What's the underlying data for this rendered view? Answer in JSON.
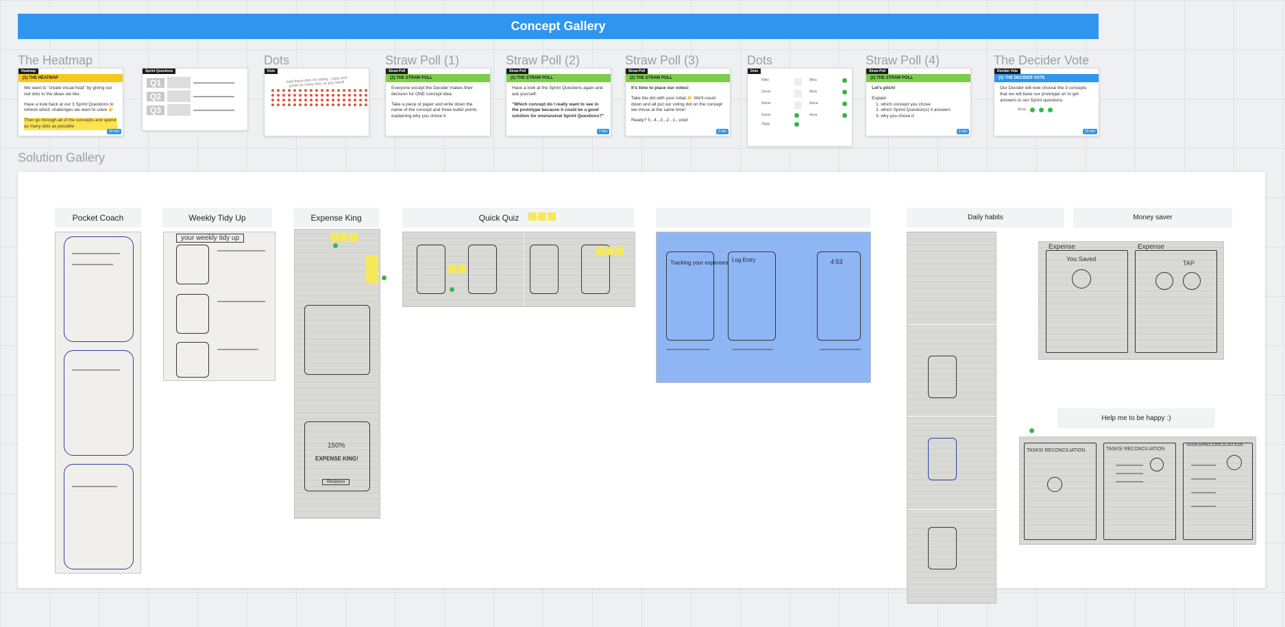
{
  "concept_gallery": {
    "title": "Concept Gallery"
  },
  "frames": {
    "heatmap": "The Heatmap",
    "dots1": "Dots",
    "straw1": "Straw Poll (1)",
    "straw2": "Straw Poll (2)",
    "straw3": "Straw Poll (3)",
    "dots2": "Dots",
    "straw4": "Straw Poll (4)",
    "decider": "The Decider Vote",
    "solution": "Solution Gallery"
  },
  "cards": {
    "heatmap": {
      "tag": "Heatmap",
      "head": "(1)   THE HEATMAP",
      "p1": "We want to \"create visual heat\" by giving out red dots to the ideas we like.",
      "p2": "Have a look back at our 3 Sprint Questions to refresh which challenges we want to solve 👉",
      "p3": "Then go through all of the concepts and spend as many dots as possible",
      "chip": "20 min"
    },
    "sprint_questions": {
      "tag": "Sprint Questions",
      "q1": "Q1",
      "q2": "Q2",
      "q3": "Q3"
    },
    "dots1": {
      "tag": "Dots",
      "note": "Add these dots for voting - copy and paste as many dots as you need!"
    },
    "straw1": {
      "tag": "Straw Poll",
      "head": "(2)   THE STRAW POLL",
      "p1": "Everyone except the Decider makes their decision for ONE concept idea.",
      "p2": "Take a piece of paper and write down the name of the concept and three bullet points explaining why you chose it."
    },
    "straw2": {
      "tag": "Straw Poll",
      "head": "(2)   THE STRAW POLL",
      "p1": "Have a look at the Sprint Questions again and ask yourself:",
      "p2": "\"Which concept do I really want to see in the prototype because it could be a good solution for one/several Sprint Questions?\"",
      "chip": "7 min"
    },
    "straw3": {
      "tag": "Straw Poll",
      "head": "(2)   THE STRAW POLL",
      "p1": "It's time to place our votes!",
      "p2": "Take the dot with your initial 👉 We'll count down and all put our voting dot on the concept we chose at the same time!",
      "p3": "Ready? 5...4...3...2...1...vote!",
      "chip": "2 min"
    },
    "dots2": {
      "tag": "Dots",
      "names": [
        "Nikki",
        "Mina",
        "Oscar",
        "Mark",
        "Martin",
        "Maria",
        "Sylvia",
        "Anna",
        "Ziggy"
      ]
    },
    "straw4": {
      "tag": "Straw Poll",
      "head": "(2)   THE STRAW POLL",
      "p1": "Let's pitch!",
      "p2": "Explain",
      "items": [
        "1. which concept you chose",
        "2. which Sprint Question(s) it answers",
        "3. why you chose it."
      ],
      "chip": "3 min"
    },
    "decider": {
      "tag": "Decider Vote",
      "head": "(3)   THE DECIDER VOTE",
      "p1": "Our Decider will now choose the 3 concepts that we will base our prototype on to get answers to our Sprint questions.",
      "label": "Anna",
      "chip": "15 min"
    }
  },
  "solutions": {
    "pocket_coach": "Pocket Coach",
    "weekly_tidy_up": "Weekly Tidy Up",
    "expense_king": "Expense King",
    "quick_quiz": "Quick Quiz",
    "daily_habits": "Daily habits",
    "money_saver": "Money saver",
    "help_me": "Help me to be happy :)"
  },
  "sketch_text": {
    "weekly_header": "your weekly tidy up",
    "expense_card": "EXPENSE KING!",
    "expense_button": "Redeem",
    "expense_pct": "150%",
    "money_saver_a": "Expense",
    "money_saver_b": "Expense",
    "money_saver_c": "You Saved",
    "money_saver_d": "TAP",
    "happy_a": "TASKS/ RECONCILIATION",
    "happy_b": "TASKS/ RECONCILIATION",
    "happy_c": "TASKS/RECONCILIATION",
    "blue_a": "Tracking your expenses",
    "blue_b": "Log Entry",
    "blue_c": "4:53"
  },
  "colors": {
    "banner": "#2f96ef",
    "heatmap_band": "#f7c81d",
    "straw_band": "#7ccd4c",
    "decider_band": "#2f96ef",
    "vote_dot": "#e2533c",
    "decider_dot": "#3bb54a"
  }
}
